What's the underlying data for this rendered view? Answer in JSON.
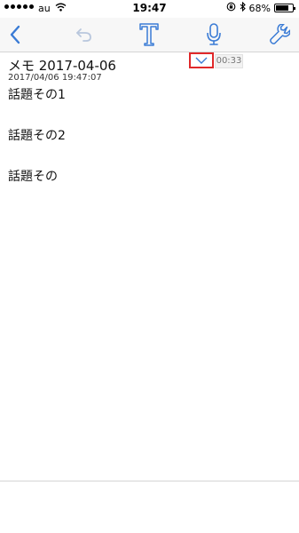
{
  "status_bar": {
    "carrier": "au",
    "time": "19:47",
    "battery": "68%",
    "battery_level": 0.68
  },
  "toolbar": {
    "back_icon": "chevron-left-icon",
    "undo_icon": "undo-icon",
    "text_icon": "text-icon",
    "mic_icon": "microphone-icon",
    "settings_icon": "wrench-icon",
    "accent_color": "#3a7bd5"
  },
  "note": {
    "title": "メモ 2017-04-06",
    "date": "2017/04/06 19:47:07",
    "expand_icon": "chevron-down-icon",
    "duration": "00:33",
    "lines": [
      "話題その1",
      "話題その2",
      "話題その"
    ]
  }
}
